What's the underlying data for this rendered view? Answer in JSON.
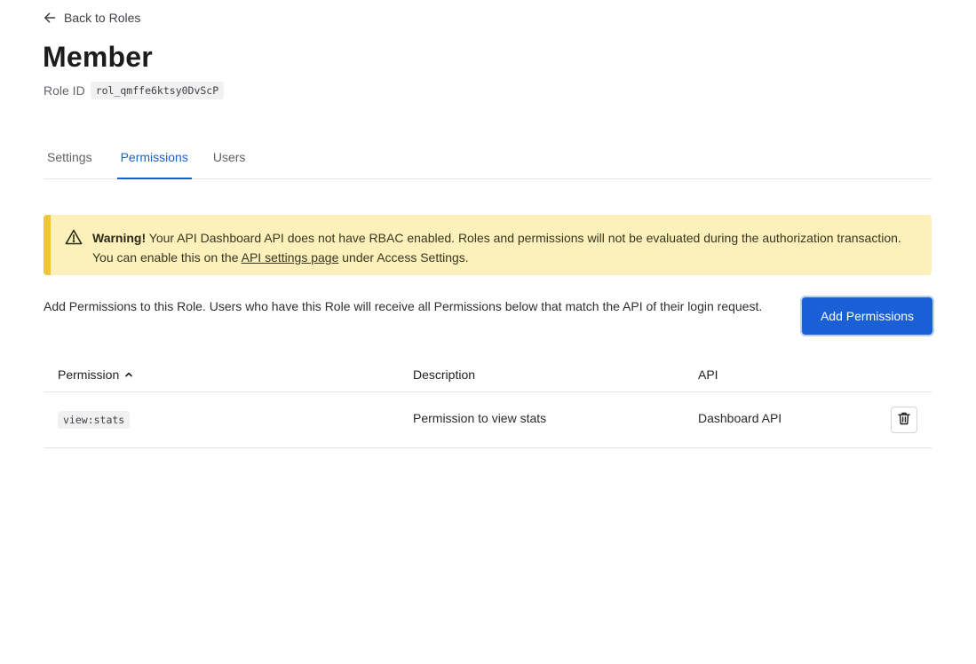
{
  "nav": {
    "back_label": "Back to Roles"
  },
  "role": {
    "title": "Member",
    "id_label": "Role ID",
    "id_value": "rol_qmffe6ktsy0DvScP"
  },
  "tabs": [
    {
      "label": "Settings",
      "active": false
    },
    {
      "label": "Permissions",
      "active": true
    },
    {
      "label": "Users",
      "active": false
    }
  ],
  "warning": {
    "title": "Warning!",
    "text_before": " Your API Dashboard API does not have RBAC enabled. Roles and permissions will not be evaluated during the authorization transaction. You can enable this on the ",
    "link": "API settings page",
    "text_after": " under Access Settings."
  },
  "intro_text": "Add Permissions to this Role. Users who have this Role will receive all Permissions below that match the API of their login request.",
  "add_button_label": "Add Permissions",
  "table": {
    "columns": [
      "Permission",
      "Description",
      "API"
    ],
    "sort": {
      "column": "Permission",
      "direction": "ascending"
    },
    "rows": [
      {
        "permission": "view:stats",
        "description": "Permission to view stats",
        "api": "Dashboard API"
      }
    ]
  },
  "icons": {
    "back": "arrow-left-icon",
    "warning": "warning-triangle-icon",
    "sort": "chevron-up-icon",
    "delete": "trash-icon"
  },
  "colors": {
    "accent": "#1a5fd6",
    "warning_bg": "#fdf1bb",
    "warning_border": "#f0c53a"
  }
}
